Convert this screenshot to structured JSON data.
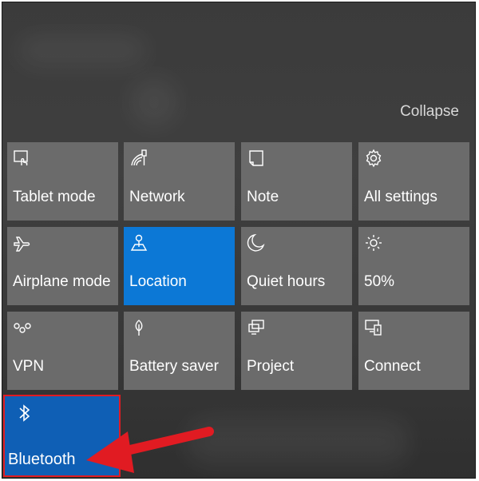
{
  "header": {
    "collapse_label": "Collapse"
  },
  "tiles": [
    {
      "label": "Tablet mode",
      "icon": "tablet-mode-icon",
      "active": false
    },
    {
      "label": "Network",
      "icon": "network-icon",
      "active": false
    },
    {
      "label": "Note",
      "icon": "note-icon",
      "active": false
    },
    {
      "label": "All settings",
      "icon": "gear-icon",
      "active": false
    },
    {
      "label": "Airplane mode",
      "icon": "airplane-icon",
      "active": false
    },
    {
      "label": "Location",
      "icon": "location-icon",
      "active": true
    },
    {
      "label": "Quiet hours",
      "icon": "moon-icon",
      "active": false
    },
    {
      "label": "50%",
      "icon": "brightness-icon",
      "active": false
    },
    {
      "label": "VPN",
      "icon": "vpn-icon",
      "active": false
    },
    {
      "label": "Battery saver",
      "icon": "battery-saver-icon",
      "active": false
    },
    {
      "label": "Project",
      "icon": "project-icon",
      "active": false
    },
    {
      "label": "Connect",
      "icon": "connect-icon",
      "active": false
    }
  ],
  "bluetooth": {
    "label": "Bluetooth",
    "icon": "bluetooth-icon",
    "active": true
  },
  "colors": {
    "tile": "#6b6b6b",
    "active_tile": "#0c78d6",
    "highlight": "#e11b22"
  }
}
